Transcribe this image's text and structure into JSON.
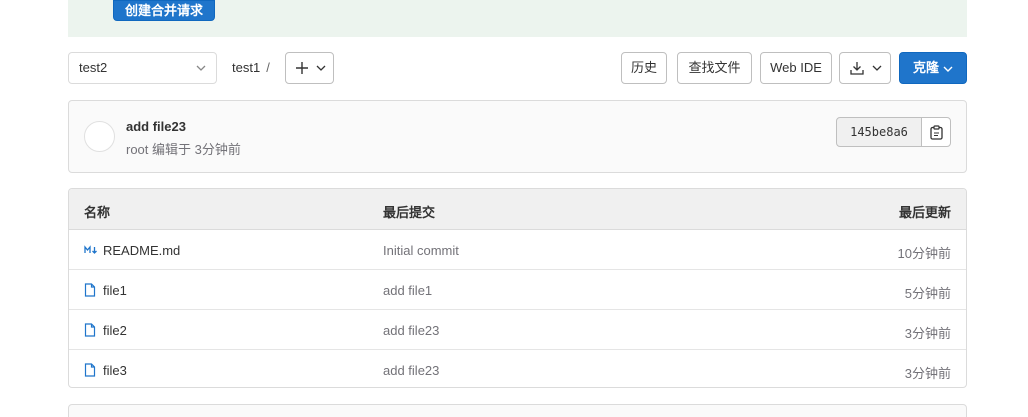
{
  "banner": {
    "create_mr_label": "创建合并请求"
  },
  "toolbar": {
    "branch": "test2",
    "path": "test1",
    "path_sep": "/",
    "history_label": "历史",
    "find_file_label": "查找文件",
    "web_ide_label": "Web IDE",
    "clone_label": "克隆"
  },
  "last_commit": {
    "title": "add file23",
    "meta": "root 编辑于 3分钟前",
    "sha": "145be8a6"
  },
  "file_table": {
    "headers": {
      "name": "名称",
      "last_commit": "最后提交",
      "last_update": "最后更新"
    },
    "rows": [
      {
        "name": "README.md",
        "icon": "markdown-icon",
        "commit": "Initial commit",
        "updated": "10分钟前"
      },
      {
        "name": "file1",
        "icon": "file-icon",
        "commit": "add file1",
        "updated": "5分钟前"
      },
      {
        "name": "file2",
        "icon": "file-icon",
        "commit": "add file23",
        "updated": "3分钟前"
      },
      {
        "name": "file3",
        "icon": "file-icon",
        "commit": "add file23",
        "updated": "3分钟前"
      }
    ]
  },
  "colors": {
    "accent": "#1f75cb",
    "banner_bg": "#ecf4ee",
    "file_icon": "#1f75cb"
  }
}
